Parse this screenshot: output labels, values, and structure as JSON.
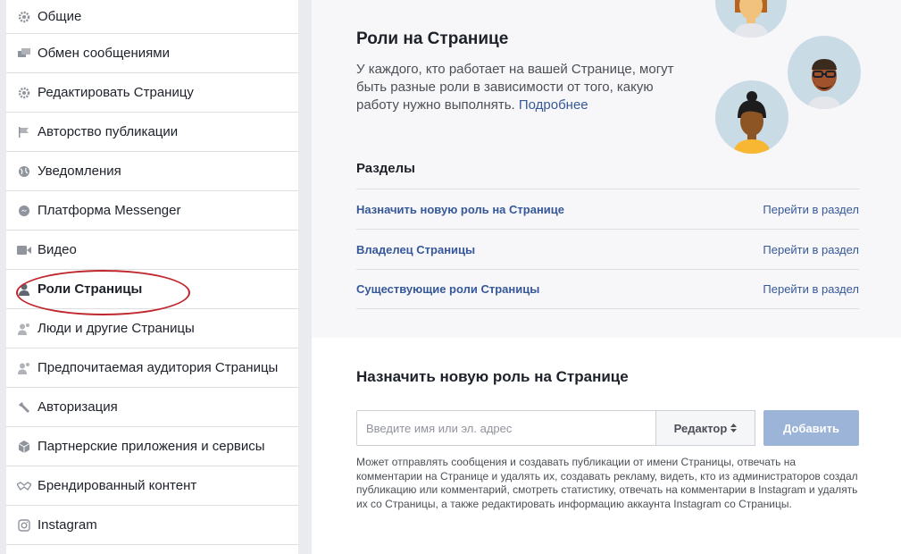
{
  "sidebar": {
    "items": [
      {
        "label": "Общие",
        "icon": "gear-icon"
      },
      {
        "label": "Обмен сообщениями",
        "icon": "messages-icon"
      },
      {
        "label": "Редактировать Страницу",
        "icon": "gear-icon"
      },
      {
        "label": "Авторство публикации",
        "icon": "flag-icon"
      },
      {
        "label": "Уведомления",
        "icon": "globe-icon"
      },
      {
        "label": "Платформа Messenger",
        "icon": "messenger-icon"
      },
      {
        "label": "Видео",
        "icon": "video-camera-icon"
      },
      {
        "label": "Роли Страницы",
        "icon": "person-icon",
        "active": true
      },
      {
        "label": "Люди и другие Страницы",
        "icon": "people-icon"
      },
      {
        "label": "Предпочитаемая аудитория Страницы",
        "icon": "people-icon"
      },
      {
        "label": "Авторизация",
        "icon": "wrench-icon"
      },
      {
        "label": "Партнерские приложения и сервисы",
        "icon": "cube-icon"
      },
      {
        "label": "Брендированный контент",
        "icon": "handshake-icon"
      },
      {
        "label": "Instagram",
        "icon": "instagram-icon"
      }
    ],
    "highlight_color": "#c0272d"
  },
  "roles_section": {
    "title": "Роли на Странице",
    "description": "У каждого, кто работает на вашей Странице, могут быть разные роли в зависимости от того, какую работу нужно выполнять.",
    "more_link": "Подробнее"
  },
  "sections": {
    "heading": "Разделы",
    "rows": [
      {
        "label": "Назначить новую роль на Странице",
        "action": "Перейти в раздел"
      },
      {
        "label": "Владелец Страницы",
        "action": "Перейти в раздел"
      },
      {
        "label": "Существующие роли Страницы",
        "action": "Перейти в раздел"
      }
    ]
  },
  "assign_role": {
    "title": "Назначить новую роль на Странице",
    "input_placeholder": "Введите имя или эл. адрес",
    "input_value": "",
    "role_selected": "Редактор",
    "add_label": "Добавить",
    "role_description": "Может отправлять сообщения и создавать публикации от имени Страницы, отвечать на комментарии на Странице и удалять их, создавать рекламу, видеть, кто из администраторов создал публикацию или комментарий, смотреть статистику, отвечать на комментарии в Instagram и удалять их со Страницы, а также редактировать информацию аккаунта Instagram со Страницы."
  },
  "colors": {
    "link": "#365899",
    "button_disabled": "#9cb4d8",
    "avatar_bg": "#c9dbe5"
  }
}
